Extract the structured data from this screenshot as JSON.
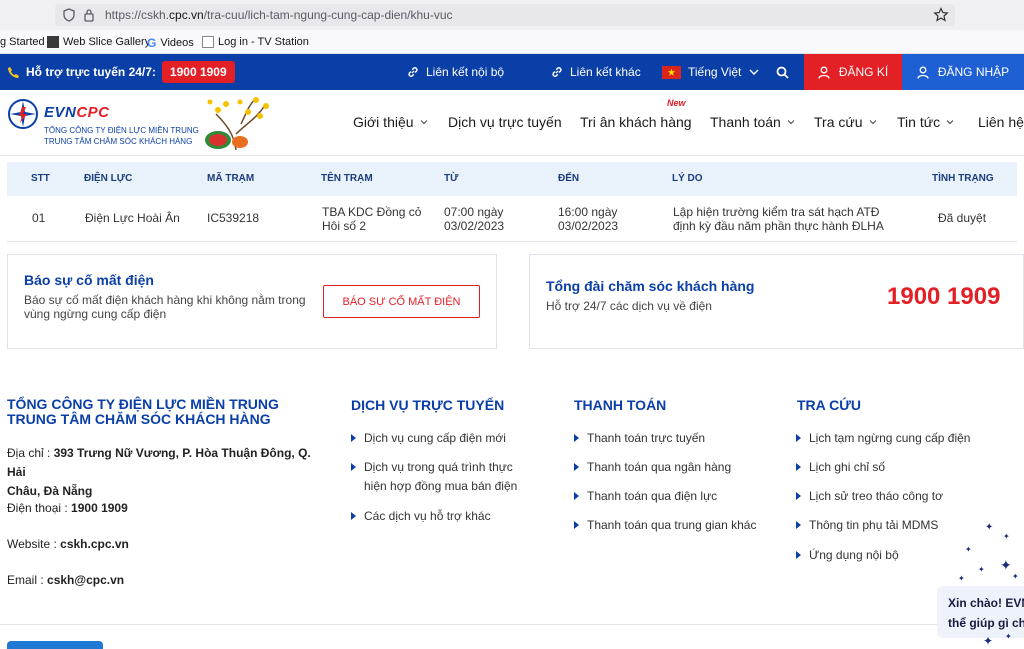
{
  "browser": {
    "url_prefix": "https://cskh.",
    "url_domain": "cpc.vn",
    "url_path": "/tra-cuu/lich-tam-ngung-cung-cap-dien/khu-vuc",
    "bookmarks": [
      "g Started",
      "Web Slice Gallery",
      "Videos",
      "Log in - TV Station"
    ]
  },
  "topbar": {
    "support_label": "Hỗ trợ trực tuyến 24/7:",
    "support_phone": "1900 1909",
    "internal_links": "Liên kết nội bộ",
    "other_links": "Liên kết khác",
    "language": "Tiếng Việt",
    "register": "ĐĂNG KÍ",
    "login": "ĐĂNG NHẬP"
  },
  "header": {
    "logo_text_1": "EVN",
    "logo_text_2": "CPC",
    "logo_sub_1": "TỔNG CÔNG TY ĐIỆN LỰC MIỀN TRUNG",
    "logo_sub_2": "TRUNG TÂM CHĂM SÓC KHÁCH HÀNG",
    "new_badge": "New",
    "nav": [
      "Giới thiệu",
      "Dịch vụ trực tuyến",
      "Tri ân khách hàng",
      "Thanh toán",
      "Tra cứu",
      "Tin tức",
      "Liên hệ"
    ]
  },
  "table": {
    "headers": [
      "STT",
      "ĐIỆN LỰC",
      "MÃ TRẠM",
      "TÊN TRẠM",
      "TỪ",
      "ĐẾN",
      "LÝ DO",
      "TÌNH TRẠNG"
    ],
    "rows": [
      {
        "stt": "01",
        "dien_luc": "Điện Lực Hoài Ân",
        "ma_tram": "IC539218",
        "ten_tram_1": "TBA KDC Đồng cỏ",
        "ten_tram_2": "Hôi số 2",
        "tu_1": "07:00 ngày",
        "tu_2": "03/02/2023",
        "den_1": "16:00 ngày",
        "den_2": "03/02/2023",
        "ly_do_1": "Lập hiện trường kiểm tra sát hạch ATĐ",
        "ly_do_2": "định kỳ đầu năm phần thực hành ĐLHA",
        "tinh_trang": "Đã duyệt"
      }
    ]
  },
  "report_card": {
    "title": "Báo sự cố mất điện",
    "text_1": "Báo sự cố mất điện khách hàng khi không nằm trong",
    "text_2": "vùng ngừng cung cấp điện",
    "button": "BÁO SỰ CỐ MẤT ĐIỆN"
  },
  "hotline_card": {
    "title": "Tổng đài chăm sóc khách hàng",
    "text": "Hỗ trợ 24/7 các dịch vụ về điện",
    "phone": "1900 1909"
  },
  "footer": {
    "company_1": "TỔNG CÔNG TY ĐIỆN LỰC MIỀN TRUNG",
    "company_2": "TRUNG TÂM CHĂM SÓC KHÁCH HÀNG",
    "address_label": "Địa chỉ : ",
    "address_1": "393 Trưng Nữ Vương, P. Hòa Thuận Đông, Q. Hải",
    "address_2": "Châu, Đà Nẵng",
    "phone_label": "Điện thoại : ",
    "phone": "1900 1909",
    "website_label": "Website : ",
    "website": "cskh.cpc.vn",
    "email_label": "Email : ",
    "email": "cskh@cpc.vn",
    "col_online": {
      "title": "DỊCH VỤ TRỰC TUYẾN",
      "links": [
        "Dịch vụ cung cấp điện mới",
        "Dịch vụ trong quá trình thực",
        "hiện hợp đồng mua bán điện",
        "Các dịch vụ hỗ trợ khác"
      ]
    },
    "col_payment": {
      "title": "THANH TOÁN",
      "links": [
        "Thanh toán trực tuyến",
        "Thanh toán qua ngân hàng",
        "Thanh toán qua điện lực",
        "Thanh toán qua trung gian khác"
      ]
    },
    "col_lookup": {
      "title": "TRA CỨU",
      "links": [
        "Lịch tạm ngừng cung cấp điện",
        "Lịch ghi chỉ số",
        "Lịch sử treo tháo công tơ",
        "Thông tin phụ tải MDMS",
        "Ứng dụng nội bộ"
      ]
    }
  },
  "chat": {
    "line_1": "Xin chào! EVNC",
    "line_2": "thể giúp gì cho"
  },
  "colors": {
    "brand_blue": "#0b3fa8",
    "brand_red": "#e42027",
    "login_blue": "#1f5fd4"
  }
}
